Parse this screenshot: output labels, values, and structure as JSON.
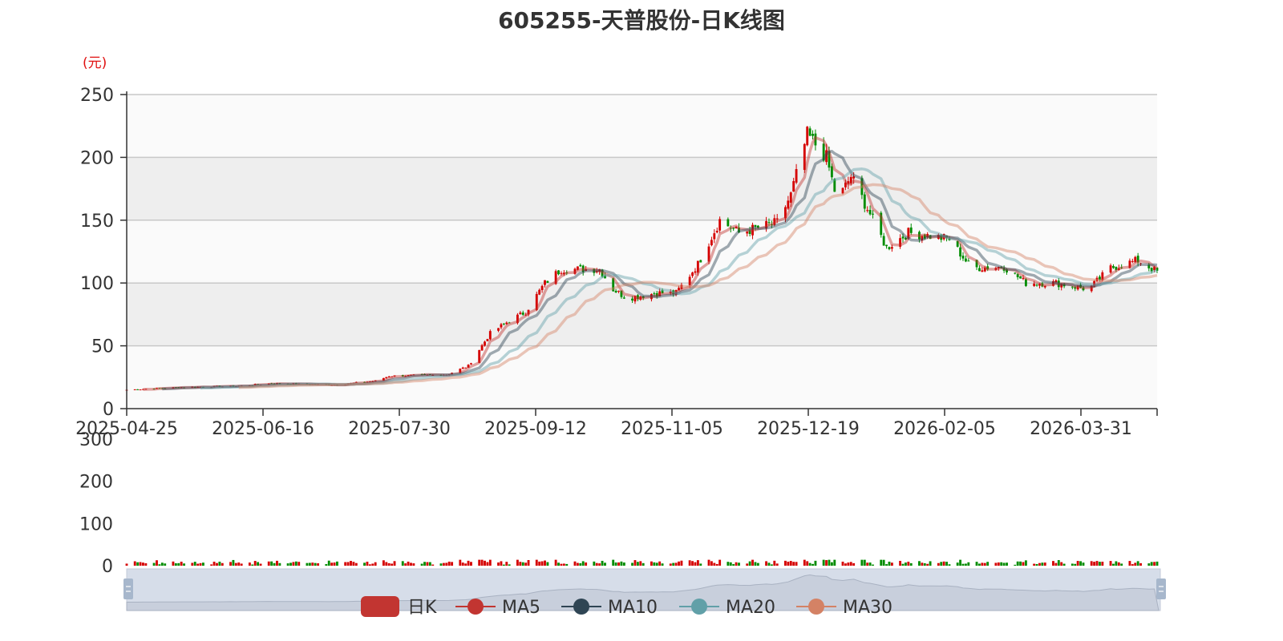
{
  "chart_data": {
    "type": "candlestick",
    "title": "605255-天普股份-日K线图",
    "y_unit": "(元)",
    "ylim": [
      0,
      250
    ],
    "y_ticks": [
      0,
      50,
      100,
      150,
      200,
      250
    ],
    "volume_ylim": [
      0,
      300
    ],
    "volume_ticks": [
      0,
      100,
      200,
      300
    ],
    "x_range": [
      "2025-04-25",
      "2026-05-07"
    ],
    "x_tick_labels": [
      "2025-04-25",
      "2025-06-16",
      "2025-07-30",
      "2025-09-12",
      "2025-11-05",
      "2025-12-19",
      "2026-02-05",
      "2026-03-31"
    ],
    "close_path": [
      [
        "2025-04-25",
        15
      ],
      [
        "2025-05-15",
        17
      ],
      [
        "2025-06-05",
        18
      ],
      [
        "2025-06-16",
        20
      ],
      [
        "2025-07-10",
        19
      ],
      [
        "2025-07-25",
        22
      ],
      [
        "2025-07-30",
        26
      ],
      [
        "2025-08-20",
        27
      ],
      [
        "2025-08-28",
        34
      ],
      [
        "2025-09-05",
        60
      ],
      [
        "2025-09-12",
        70
      ],
      [
        "2025-09-18",
        77
      ],
      [
        "2025-09-25",
        100
      ],
      [
        "2025-10-01",
        111
      ],
      [
        "2025-10-15",
        111
      ],
      [
        "2025-10-20",
        95
      ],
      [
        "2025-10-25",
        88
      ],
      [
        "2025-11-05",
        92
      ],
      [
        "2025-11-12",
        92
      ],
      [
        "2025-11-20",
        115
      ],
      [
        "2025-11-28",
        150
      ],
      [
        "2025-12-05",
        140
      ],
      [
        "2025-12-19",
        148
      ],
      [
        "2025-12-24",
        170
      ],
      [
        "2025-12-30",
        218
      ],
      [
        "2026-01-06",
        200
      ],
      [
        "2026-01-10",
        165
      ],
      [
        "2026-01-15",
        185
      ],
      [
        "2026-01-22",
        155
      ],
      [
        "2026-01-28",
        128
      ],
      [
        "2026-02-05",
        140
      ],
      [
        "2026-02-20",
        135
      ],
      [
        "2026-02-28",
        112
      ],
      [
        "2026-03-12",
        113
      ],
      [
        "2026-03-20",
        100
      ],
      [
        "2026-03-31",
        100
      ],
      [
        "2026-04-12",
        95
      ],
      [
        "2026-04-20",
        112
      ],
      [
        "2026-04-30",
        118
      ],
      [
        "2026-05-07",
        109
      ]
    ],
    "series": [
      {
        "name": "日K",
        "color": "#c23531"
      },
      {
        "name": "MA5",
        "color": "#c23531"
      },
      {
        "name": "MA10",
        "color": "#2f4554"
      },
      {
        "name": "MA20",
        "color": "#61a0a8"
      },
      {
        "name": "MA30",
        "color": "#d48265"
      }
    ],
    "up_color": "#d50000",
    "down_color": "#008c00",
    "grid": true,
    "legend_position": "bottom"
  }
}
